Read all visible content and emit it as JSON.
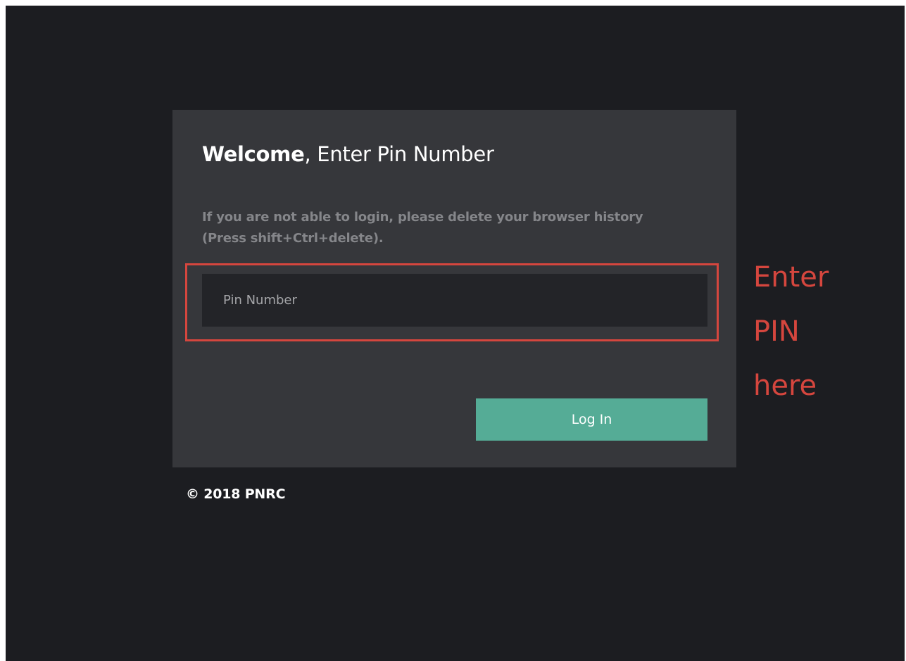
{
  "login": {
    "title_bold": "Welcome",
    "title_rest": ", Enter Pin Number",
    "hint": "If you are not able to login, please delete your browser history (Press shift+Ctrl+delete).",
    "pin_placeholder": "Pin Number",
    "pin_value": "",
    "login_label": "Log In"
  },
  "footer": {
    "copyright": "© 2018 PNRC"
  },
  "annotation": {
    "text": "Enter PIN here",
    "color": "#d5463e"
  },
  "colors": {
    "background": "#1c1d21",
    "card": "#36373b",
    "input": "#232428",
    "accent": "#55ac96"
  }
}
